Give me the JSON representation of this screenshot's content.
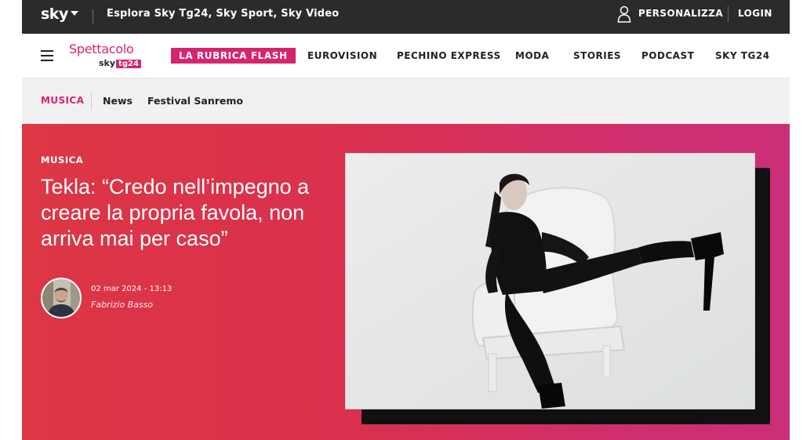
{
  "topbar": {
    "logo": "sky",
    "explore": "Esplora Sky Tg24, Sky Sport, Sky Video",
    "personalize": "PERSONALIZZA",
    "login": "LOGIN"
  },
  "brand": {
    "name": "Spettacolo",
    "sub": "sky",
    "sub_badge": "tg24"
  },
  "nav": {
    "highlight": "LA RUBRICA FLASH",
    "items": [
      "EUROVISION",
      "PECHINO EXPRESS",
      "MODA",
      "STORIES",
      "PODCAST",
      "SKY TG24"
    ]
  },
  "subnav": {
    "active": "MUSICA",
    "items": [
      "News",
      "Festival Sanremo"
    ]
  },
  "article": {
    "category": "MUSICA",
    "title": "Tekla: “Credo nell’impegno a creare la propria favola, non arriva mai per caso”",
    "date": "02 mar 2024 - 13:13",
    "author": "Fabrizio Basso"
  },
  "colors": {
    "accent": "#d6246e",
    "topbar": "#2b2b2b",
    "hero_start": "#dd3644",
    "hero_end": "#cb2f78"
  },
  "icons": [
    "sky-logo",
    "chevron-down-icon",
    "user-icon",
    "hamburger-menu-icon"
  ]
}
